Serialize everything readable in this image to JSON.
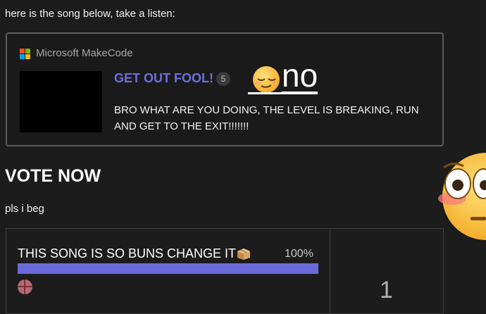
{
  "post": {
    "intro_text": "here is the song below, take a listen:"
  },
  "onebox": {
    "source_name": "Microsoft MakeCode",
    "title": "GET OUT FOOL!",
    "count_badge": "5",
    "description": "BRO WHAT ARE YOU DOING, THE LEVEL IS BREAKING, RUN AND GET TO THE EXIT!!!!!!!"
  },
  "sticker": {
    "text": "no",
    "icon": "relieved-face-emoji"
  },
  "vote": {
    "heading": "VOTE NOW",
    "plead_text": "pls i beg"
  },
  "poll": {
    "options": [
      {
        "label": "THIS SONG IS SO BUNS CHANGE IT",
        "icon": "package-emoji",
        "percent_label": "100%",
        "percent": 100
      }
    ],
    "total_voters": "1",
    "bar_color": "#6a6ad8"
  },
  "overlay": {
    "icon": "flushed-face-emoji"
  },
  "colors": {
    "background": "#1c1c1c",
    "link_title": "#6f6fdf",
    "border": "#5c5c5c"
  }
}
